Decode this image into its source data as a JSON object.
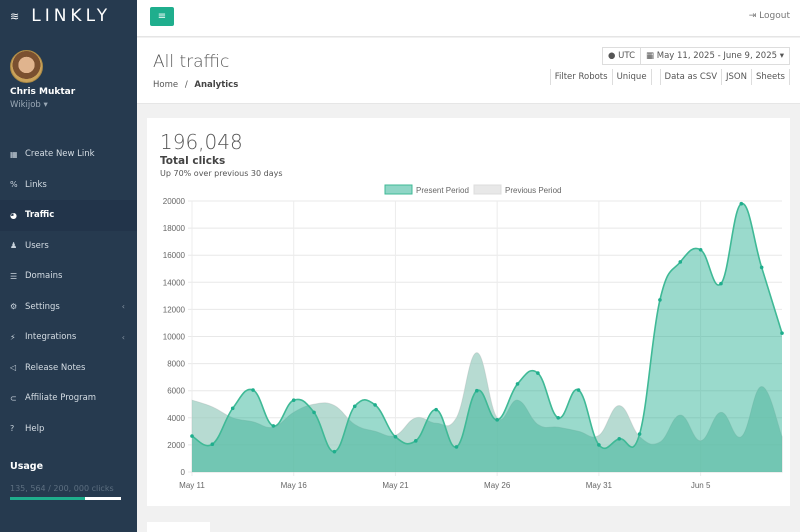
{
  "brand": {
    "name": "LINKLY",
    "icon": "layers-icon"
  },
  "user": {
    "name": "Chris Muktar",
    "org": "Wikijob"
  },
  "sidebar": {
    "items": [
      {
        "label": "Create New Link",
        "icon": "th-icon"
      },
      {
        "label": "Links",
        "icon": "link-icon"
      },
      {
        "label": "Traffic",
        "icon": "pie-chart-icon",
        "active": true
      },
      {
        "label": "Users",
        "icon": "user-icon"
      },
      {
        "label": "Domains",
        "icon": "list-icon"
      },
      {
        "label": "Settings",
        "icon": "cogs-icon",
        "submenu": true
      },
      {
        "label": "Integrations",
        "icon": "plug-icon",
        "submenu": true
      },
      {
        "label": "Release Notes",
        "icon": "bullhorn-icon"
      },
      {
        "label": "Affiliate Program",
        "icon": "handshake-icon"
      },
      {
        "label": "Help",
        "icon": "question-icon"
      }
    ]
  },
  "usage": {
    "title": "Usage",
    "text": "135, 564 / 200, 000 clicks",
    "fraction": 0.678
  },
  "topbar": {
    "logout": "Logout"
  },
  "page": {
    "title": "All traffic",
    "breadcrumb_home": "Home",
    "breadcrumb_sep": "/",
    "breadcrumb_current": "Analytics"
  },
  "toolbar": {
    "timezone": "UTC",
    "date_range": "May 11, 2025 - June 9, 2025",
    "filter_robots": "Filter Robots",
    "unique": "Unique",
    "csv": "Data as CSV",
    "json": "JSON",
    "sheets": "Sheets"
  },
  "summary": {
    "total": "196,048",
    "label": "Total clicks",
    "sub": "Up 70% over previous 30 days"
  },
  "colors": {
    "accent": "#1fae8d",
    "sidebar": "#263a4f",
    "present": "#7fcfb9",
    "previous": "#e6e6e6"
  },
  "chart_data": {
    "type": "area",
    "x": [
      "May 11",
      "May 12",
      "May 13",
      "May 14",
      "May 15",
      "May 16",
      "May 17",
      "May 18",
      "May 19",
      "May 20",
      "May 21",
      "May 22",
      "May 23",
      "May 24",
      "May 25",
      "May 26",
      "May 27",
      "May 28",
      "May 29",
      "May 30",
      "May 31",
      "Jun 1",
      "Jun 2",
      "Jun 3",
      "Jun 4",
      "Jun 5",
      "Jun 6",
      "Jun 7",
      "Jun 8",
      "Jun 9"
    ],
    "x_tick_labels": [
      "May 11",
      "May 16",
      "May 21",
      "May 26",
      "May 31",
      "Jun 5"
    ],
    "ylim": [
      0,
      20000
    ],
    "y_ticks": [
      0,
      2000,
      4000,
      6000,
      8000,
      10000,
      12000,
      14000,
      16000,
      18000,
      20000
    ],
    "grid": true,
    "legend": "top",
    "series": [
      {
        "name": "Present Period",
        "values": [
          2650,
          2050,
          4700,
          6050,
          3400,
          5300,
          4400,
          1500,
          4850,
          4950,
          2600,
          2300,
          4600,
          1850,
          6000,
          3850,
          6500,
          7300,
          4000,
          6050,
          2000,
          2450,
          2800,
          12700,
          15500,
          16400,
          13900,
          19800,
          15100,
          10250
        ]
      },
      {
        "name": "Previous Period",
        "values": [
          5300,
          4800,
          4000,
          3700,
          3300,
          4400,
          5000,
          4900,
          3500,
          3000,
          2700,
          4000,
          3600,
          4000,
          8800,
          4000,
          5300,
          3500,
          3300,
          3000,
          2700,
          4900,
          2600,
          2200,
          4200,
          2300,
          4400,
          2600,
          6300,
          2600
        ]
      }
    ]
  }
}
